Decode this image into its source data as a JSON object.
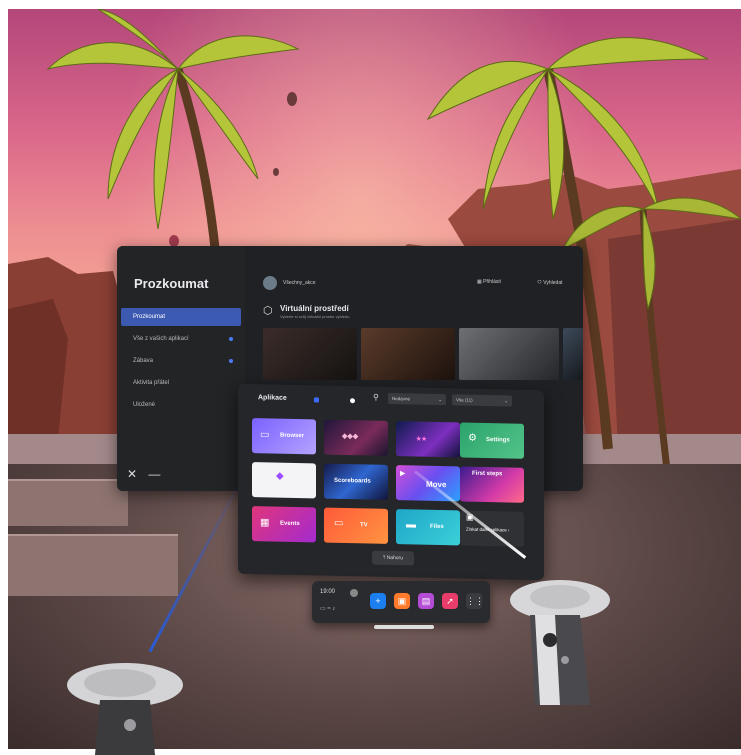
{
  "explore_panel": {
    "title": "Prozkoumat",
    "user": "Všechny_akce",
    "header_actions": [
      "Přihlásit",
      "Vyhledat"
    ],
    "nav_items": [
      {
        "label": "Prozkoumat",
        "active": true
      },
      {
        "label": "Vše z vašich aplikací",
        "dot": true
      },
      {
        "label": "Zábava",
        "dot": true
      },
      {
        "label": "Aktivita přátel"
      },
      {
        "label": "Uložené"
      }
    ],
    "section_title": "Virtuální prostředí",
    "section_subtitle": "Vyberte si svůj virtuální prostor výhledu",
    "close_icon": "✕",
    "minimize_icon": "—"
  },
  "library_panel": {
    "title": "Aplikace",
    "sort_dropdown": "Nedávné",
    "filter_dropdown": "Vše (11)",
    "tiles": [
      {
        "label": "Browser",
        "icon": "browser-icon"
      },
      {
        "label": "",
        "icon": "game-cover-1"
      },
      {
        "label": "",
        "icon": "game-cover-2"
      },
      {
        "label": "Settings",
        "icon": "gear-icon"
      },
      {
        "label": "",
        "icon": "app-logo"
      },
      {
        "label": "Scoreboards",
        "icon": "scoreboards-cover"
      },
      {
        "label": "Move",
        "icon": "move-cover"
      },
      {
        "label": "First steps",
        "icon": "first-steps-cover"
      },
      {
        "label": "Events",
        "icon": "calendar-icon"
      },
      {
        "label": "TV",
        "icon": "tv-icon"
      },
      {
        "label": "Files",
        "icon": "folder-icon"
      },
      {
        "label": "Získat další aplikace ›",
        "icon": "store-icon"
      }
    ],
    "scroll_up_label": "Nahoru"
  },
  "dock": {
    "time": "19:00",
    "buttons": [
      "add-icon",
      "store-icon",
      "chat-icon",
      "share-icon",
      "apps-grid-icon"
    ]
  },
  "colors": {
    "accent": "#3d5ab3",
    "panel_bg": "#1f2124",
    "library_bg": "#252629"
  }
}
